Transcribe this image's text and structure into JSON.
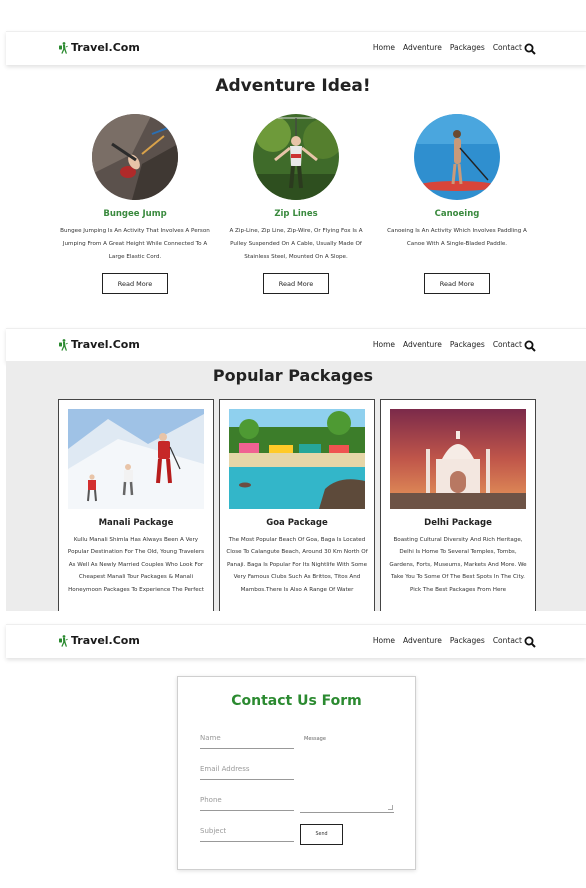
{
  "brand": {
    "name": "Travel.Com",
    "color": "#2b8a30"
  },
  "nav": {
    "items": [
      "Home",
      "Adventure",
      "Packages",
      "Contact"
    ],
    "search_icon": "search-icon"
  },
  "adventure": {
    "title": "Adventure Idea!",
    "items": [
      {
        "title": "Bungee Jump",
        "desc": "Bungee Jumping Is An Activity That Involves A Person Jumping From A Great Height While Connected To A Large Elastic Cord.",
        "button": "Read More"
      },
      {
        "title": "Zip Lines",
        "desc": "A Zip-Line, Zip Line, Zip-Wire, Or Flying Fox Is A Pulley Suspended On A Cable, Usually Made Of Stainless Steel, Mounted On A Slope.",
        "button": "Read More"
      },
      {
        "title": "Canoeing",
        "desc": "Canoeing Is An Activity Which Involves Paddling A Canoe With A Single-Bladed Paddle.",
        "button": "Read More"
      }
    ]
  },
  "packages": {
    "title": "Popular Packages",
    "items": [
      {
        "title": "Manali Package",
        "desc": "Kullu Manali Shimla Has Always Been A Very Popular Destination For The Old, Young Travelers As Well As Newly Married Couples Who Look For Cheapest Manali Tour Packages & Manali Honeymoon Packages To Experience The Perfect"
      },
      {
        "title": "Goa Package",
        "desc": "The Most Popular Beach Of Goa, Baga Is Located Close To Calangute Beach, Around 30 Km North Of Panaji. Baga Is Popular For Its Nightlife With Some Very Famous Clubs Such As Brittos, Titos And Mambos.There Is Also A Range Of Water"
      },
      {
        "title": "Delhi Package",
        "desc": "Boasting Cultural Diversity And Rich Heritage, Delhi Is Home To Several Temples, Tombs, Gardens, Forts, Museums, Markets And More. We Take You To Some Of The Best Spots In The City. Pick The Best Packages From Here"
      }
    ]
  },
  "contact": {
    "title": "Contact Us Form",
    "name_placeholder": "Name",
    "email_placeholder": "Email Address",
    "phone_placeholder": "Phone",
    "subject_placeholder": "Subject",
    "message_label": "Message",
    "send_label": "Send"
  }
}
